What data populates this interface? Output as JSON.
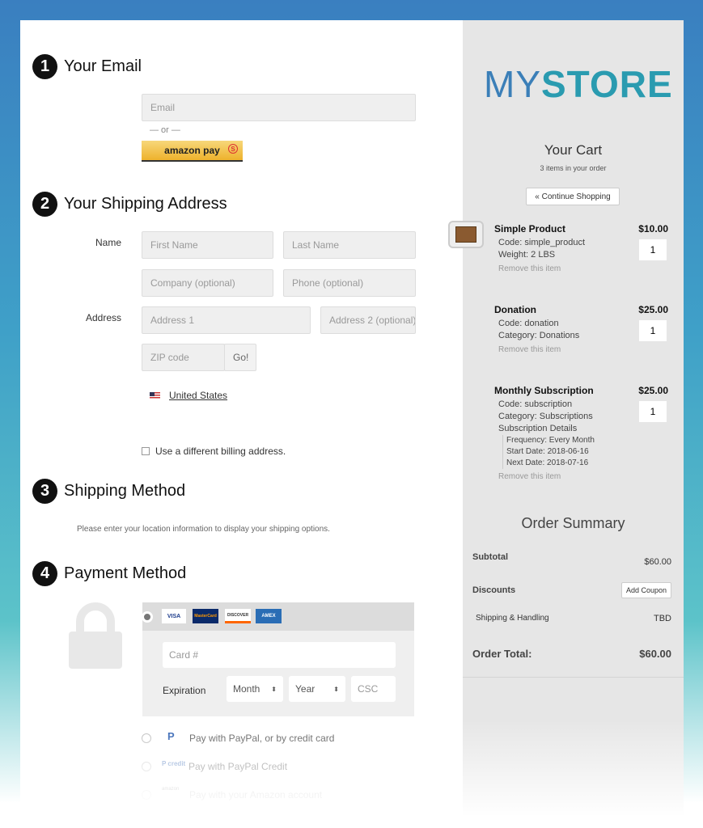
{
  "email": {
    "number": "1",
    "title": "Your Email",
    "placeholder": "Email",
    "or": "— or —",
    "amazon_pay": "amazon pay"
  },
  "shipping": {
    "number": "2",
    "title": "Your Shipping Address",
    "name_label": "Name",
    "first": "First Name",
    "last": "Last Name",
    "company": "Company (optional)",
    "phone": "Phone (optional)",
    "address_label": "Address",
    "address1": "Address 1",
    "address2": "Address 2 (optional)",
    "zip": "ZIP code",
    "go": "Go!",
    "country": "United States",
    "billing": "Use a different billing address."
  },
  "shipping_method": {
    "number": "3",
    "title": "Shipping Method",
    "note": "Please enter your location information to display your shipping options."
  },
  "payment": {
    "number": "4",
    "title": "Payment Method",
    "cards": [
      "VISA",
      "MasterCard",
      "DISCOVER",
      "AMEX"
    ],
    "card_placeholder": "Card #",
    "expiration": "Expiration",
    "month": "Month",
    "year": "Year",
    "csc": "CSC",
    "options": [
      "Pay with PayPal, or by credit card",
      "Pay with PayPal Credit",
      "Pay with your Amazon account"
    ]
  },
  "store": {
    "logo_a": "MY",
    "logo_b": "STORE",
    "cart_title": "Your Cart",
    "cart_count": "3 items in your order",
    "continue": "« Continue Shopping"
  },
  "cart": [
    {
      "name": "Simple Product",
      "price": "$10.00",
      "qty": "1",
      "meta": [
        "Code: simple_product",
        "Weight: 2 LBS"
      ],
      "details": [],
      "remove": "Remove this item"
    },
    {
      "name": "Donation",
      "price": "$25.00",
      "qty": "1",
      "meta": [
        "Code: donation",
        "Category: Donations"
      ],
      "details": [],
      "remove": "Remove this item"
    },
    {
      "name": "Monthly Subscription",
      "price": "$25.00",
      "qty": "1",
      "meta": [
        "Code: subscription",
        "Category: Subscriptions",
        "Subscription Details"
      ],
      "details": [
        "Frequency: Every Month",
        "Start Date: 2018-06-16",
        "Next Date: 2018-07-16"
      ],
      "remove": "Remove this item"
    }
  ],
  "summary": {
    "title": "Order Summary",
    "subtotal_label": "Subtotal",
    "subtotal": "$60.00",
    "discounts_label": "Discounts",
    "coupon": "Add Coupon",
    "shipping_label": "Shipping & Handling",
    "shipping": "TBD",
    "total_label": "Order Total:",
    "total": "$60.00"
  },
  "colors": {
    "logo_my": "#3b7fb8",
    "logo_store": "#2a9bb0"
  }
}
